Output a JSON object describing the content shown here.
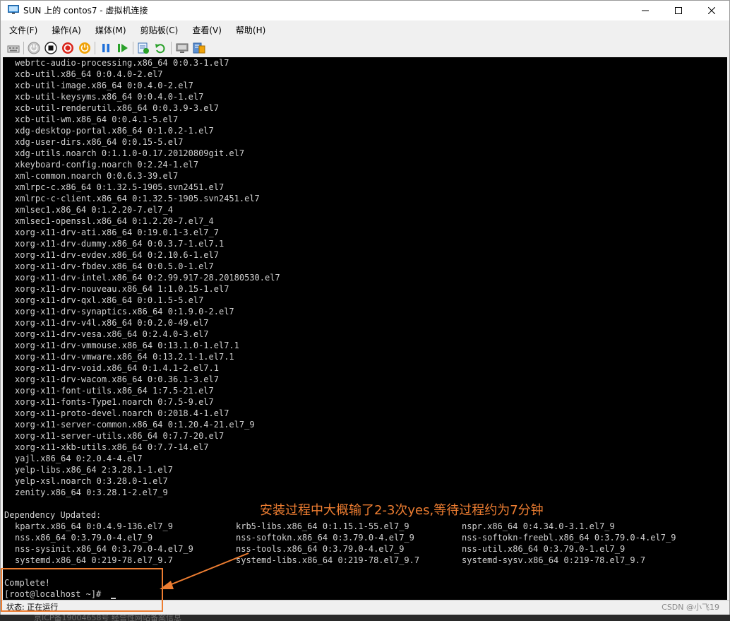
{
  "window": {
    "title": "SUN 上的 contos7 - 虚拟机连接",
    "icon": "vm-connection-icon",
    "controls": [
      "minimize-icon",
      "maximize-icon",
      "close-icon"
    ]
  },
  "menu": [
    "文件(F)",
    "操作(A)",
    "媒体(M)",
    "剪贴板(C)",
    "查看(V)",
    "帮助(H)"
  ],
  "toolbar": {
    "icons": [
      "ctrl-alt-del-icon",
      "start-icon",
      "turn-off-icon",
      "shut-down-icon",
      "power-save-icon",
      "pause-icon",
      "resume-icon",
      "checkpoint-icon",
      "revert-icon",
      "enhanced-session-icon",
      "settings-icon"
    ],
    "colors": {
      "shutdown": "#d9261c",
      "save": "#f0a30a",
      "play": "#2aa12a",
      "pause": "#1e6fd9"
    }
  },
  "console": {
    "package_lines": [
      "webrtc-audio-processing.x86_64 0:0.3-1.el7",
      "xcb-util.x86_64 0:0.4.0-2.el7",
      "xcb-util-image.x86_64 0:0.4.0-2.el7",
      "xcb-util-keysyms.x86_64 0:0.4.0-1.el7",
      "xcb-util-renderutil.x86_64 0:0.3.9-3.el7",
      "xcb-util-wm.x86_64 0:0.4.1-5.el7",
      "xdg-desktop-portal.x86_64 0:1.0.2-1.el7",
      "xdg-user-dirs.x86_64 0:0.15-5.el7",
      "xdg-utils.noarch 0:1.1.0-0.17.20120809git.el7",
      "xkeyboard-config.noarch 0:2.24-1.el7",
      "xml-common.noarch 0:0.6.3-39.el7",
      "xmlrpc-c.x86_64 0:1.32.5-1905.svn2451.el7",
      "xmlrpc-c-client.x86_64 0:1.32.5-1905.svn2451.el7",
      "xmlsec1.x86_64 0:1.2.20-7.el7_4",
      "xmlsec1-openssl.x86_64 0:1.2.20-7.el7_4",
      "xorg-x11-drv-ati.x86_64 0:19.0.1-3.el7_7",
      "xorg-x11-drv-dummy.x86_64 0:0.3.7-1.el7.1",
      "xorg-x11-drv-evdev.x86_64 0:2.10.6-1.el7",
      "xorg-x11-drv-fbdev.x86_64 0:0.5.0-1.el7",
      "xorg-x11-drv-intel.x86_64 0:2.99.917-28.20180530.el7",
      "xorg-x11-drv-nouveau.x86_64 1:1.0.15-1.el7",
      "xorg-x11-drv-qxl.x86_64 0:0.1.5-5.el7",
      "xorg-x11-drv-synaptics.x86_64 0:1.9.0-2.el7",
      "xorg-x11-drv-v4l.x86_64 0:0.2.0-49.el7",
      "xorg-x11-drv-vesa.x86_64 0:2.4.0-3.el7",
      "xorg-x11-drv-vmmouse.x86_64 0:13.1.0-1.el7.1",
      "xorg-x11-drv-vmware.x86_64 0:13.2.1-1.el7.1",
      "xorg-x11-drv-void.x86_64 0:1.4.1-2.el7.1",
      "xorg-x11-drv-wacom.x86_64 0:0.36.1-3.el7",
      "xorg-x11-font-utils.x86_64 1:7.5-21.el7",
      "xorg-x11-fonts-Type1.noarch 0:7.5-9.el7",
      "xorg-x11-proto-devel.noarch 0:2018.4-1.el7",
      "xorg-x11-server-common.x86_64 0:1.20.4-21.el7_9",
      "xorg-x11-server-utils.x86_64 0:7.7-20.el7",
      "xorg-x11-xkb-utils.x86_64 0:7.7-14.el7",
      "yajl.x86_64 0:2.0.4-4.el7",
      "yelp-libs.x86_64 2:3.28.1-1.el7",
      "yelp-xsl.noarch 0:3.28.0-1.el7",
      "zenity.x86_64 0:3.28.1-2.el7_9"
    ],
    "dependency_header": "Dependency Updated:",
    "dependency_rows": [
      [
        "kpartx.x86_64 0:0.4.9-136.el7_9",
        "krb5-libs.x86_64 0:1.15.1-55.el7_9",
        "nspr.x86_64 0:4.34.0-3.1.el7_9"
      ],
      [
        "nss.x86_64 0:3.79.0-4.el7_9",
        "nss-softokn.x86_64 0:3.79.0-4.el7_9",
        "nss-softokn-freebl.x86_64 0:3.79.0-4.el7_9"
      ],
      [
        "nss-sysinit.x86_64 0:3.79.0-4.el7_9",
        "nss-tools.x86_64 0:3.79.0-4.el7_9",
        "nss-util.x86_64 0:3.79.0-1.el7_9"
      ],
      [
        "systemd.x86_64 0:219-78.el7_9.7",
        "systemd-libs.x86_64 0:219-78.el7_9.7",
        "systemd-sysv.x86_64 0:219-78.el7_9.7"
      ]
    ],
    "complete": "Complete!",
    "prompt": "[root@localhost ~]#"
  },
  "annotation": {
    "text": "安装过程中大概输了2-3次yes,等待过程约为7分钟",
    "color": "#ed7d31"
  },
  "status": {
    "label": "状态: 正在运行",
    "right_text": "CSDN @小飞19"
  },
  "background_page": {
    "text": "京ICP备19004658号  经营性网站备案信息"
  }
}
